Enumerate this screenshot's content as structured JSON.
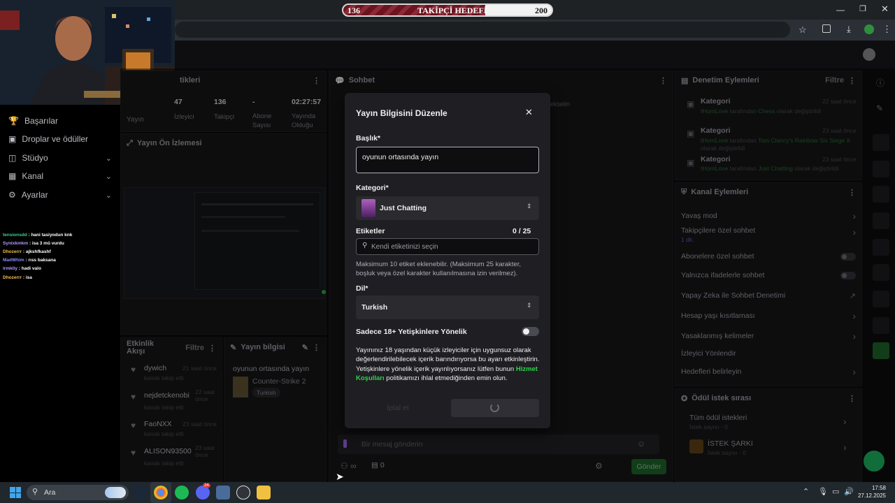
{
  "follow_goal": {
    "current": "136",
    "label": "TAKİPÇİ HEDEFİ",
    "target": "200",
    "progress": 0.68
  },
  "left_nav": {
    "items": [
      {
        "label": "Başarılar",
        "chevron": false
      },
      {
        "label": "Droplar ve ödüller",
        "chevron": false
      },
      {
        "label": "Stüdyo",
        "chevron": true
      },
      {
        "label": "Kanal",
        "chevron": true
      },
      {
        "label": "Ayarlar",
        "chevron": true
      }
    ]
  },
  "overlay_chat": [
    {
      "user": "tensionsdd",
      "color": "#3ed18a",
      "msg": "hani tasiyodun knk"
    },
    {
      "user": "Synixkmkm",
      "color": "#b49cff",
      "msg": "isa 3 mü vurdu"
    },
    {
      "user": "Dhozerrr",
      "color": "#f0c24b",
      "msg": "ajkshfkashf"
    },
    {
      "user": "MadWhim",
      "color": "#8a8cff",
      "msg": "rıss baksana"
    },
    {
      "user": "irmkliy",
      "color": "#b49cff",
      "msg": "hadi valo"
    },
    {
      "user": "Dhozerrr",
      "color": "#f0c24b",
      "msg": "isa"
    }
  ],
  "stats": {
    "title_fragment": "tikleri",
    "items": [
      {
        "value": "47",
        "label": "İzleyici"
      },
      {
        "value": "136",
        "label": "Takipçi"
      },
      {
        "value": "-",
        "label": "Abone Sayısı"
      },
      {
        "value": "02:27:57",
        "label": "Yayında Olduğu"
      }
    ],
    "left_label": "Yayın"
  },
  "preview": {
    "title": "Yayın Ön İzlemesi"
  },
  "activity": {
    "title": "Etkinlik Akışı",
    "filter": "Filtre",
    "items": [
      {
        "name": "dywich",
        "time": "21 saat önce",
        "action": "kanalı takip etti"
      },
      {
        "name": "nejdetckenobi",
        "time": "22 saat önce",
        "action": "kanalı takip etti"
      },
      {
        "name": "FaoNXX",
        "time": "23 saat önce",
        "action": "kanalı takip etti"
      },
      {
        "name": "ALISON93500",
        "time": "23 saat önce",
        "action": "kanalı takip etti"
      }
    ]
  },
  "stream_info": {
    "title": "Yayın bilgisi",
    "stream_title": "oyunun ortasında yayın",
    "game": "Counter-Strike 2",
    "tag": "Turkish"
  },
  "chat": {
    "title": "Sohbet",
    "partial_text": "ekselin",
    "input_placeholder": "Bir mesaj gönderin",
    "points": "0",
    "send": "Gönder"
  },
  "modal": {
    "title": "Yayın Bilgisini Düzenle",
    "title_label": "Başlık*",
    "title_value": "oyunun ortasında yayın",
    "category_label": "Kategori*",
    "category_value": "Just Chatting",
    "tags_label": "Etiketler",
    "tags_count": "0 / 25",
    "tags_placeholder": "Kendi etiketinizi seçin",
    "tags_help": "Maksimum 10 etiket eklenebilir. (Maksimum 25 karakter, boşluk veya özel karakter kullanılmasına izin verilmez).",
    "lang_label": "Dil*",
    "lang_value": "Turkish",
    "mature_label": "Sadece 18+ Yetişkinlere Yönelik",
    "mature_text_1": "Yayınınız 18 yaşından küçük izleyiciler için uygunsuz olarak değerlendirilebilecek içerik barındırıyorsa bu ayarı etkinleştirin. Yetişkinlere yönelik içerik yayınlıyorsanız lütfen bunun",
    "mature_link": "Hizmet Koşulları",
    "mature_text_2": "politikamızı ihlal etmediğinden emin olun.",
    "cancel": "İptal et"
  },
  "mod_actions": {
    "title": "Denetim Eylemleri",
    "filter": "Filtre",
    "items": [
      {
        "kind": "Kategori",
        "time": "22 saat önce",
        "user": "tHornLove",
        "mid": "tarafından",
        "target": "Chess",
        "end": "olarak değiştirildi"
      },
      {
        "kind": "Kategori",
        "time": "23 saat önce",
        "user": "tHornLove",
        "mid": "tarafından",
        "target": "Tom Clancy's Rainbow Six Siege X",
        "end": "olarak değiştirildi"
      },
      {
        "kind": "Kategori",
        "time": "23 saat önce",
        "user": "tHornLove",
        "mid": "tarafından",
        "target": "Just Chatting",
        "end": "olarak değiştirildi"
      }
    ]
  },
  "channel_actions": {
    "title": "Kanal Eylemleri",
    "items": [
      {
        "label": "Yavaş mod",
        "sub": "",
        "control": "chevron"
      },
      {
        "label": "Takipçilere özel sohbet",
        "sub": "1 dk.",
        "control": "chevron"
      },
      {
        "label": "Abonelere özel sohbet",
        "sub": "",
        "control": "toggle"
      },
      {
        "label": "Yalnızca ifadelerle sohbet",
        "sub": "",
        "control": "toggle"
      },
      {
        "label": "Yapay Zeka ile Sohbet Denetimi",
        "sub": "",
        "control": "external"
      },
      {
        "label": "Hesap yaşı kısıtlaması",
        "sub": "",
        "control": "chevron"
      },
      {
        "label": "Yasaklanmış kelimeler",
        "sub": "",
        "control": "chevron"
      },
      {
        "label": "İzleyici Yönlendir",
        "sub": "",
        "control": "none"
      },
      {
        "label": "Hedefleri belirleyin",
        "sub": "",
        "control": "chevron"
      }
    ]
  },
  "reward_queue": {
    "title": "Ödül istek sırası",
    "items": [
      {
        "label": "Tüm ödül istekleri",
        "sub": "İstek sayısı - 0"
      },
      {
        "label": "İSTEK ŞARKI",
        "sub": "İstek sayısı - 0"
      }
    ]
  },
  "taskbar": {
    "search": "Ara",
    "time": "17:58",
    "date": "27.12.2025",
    "discord_badge": "24"
  }
}
